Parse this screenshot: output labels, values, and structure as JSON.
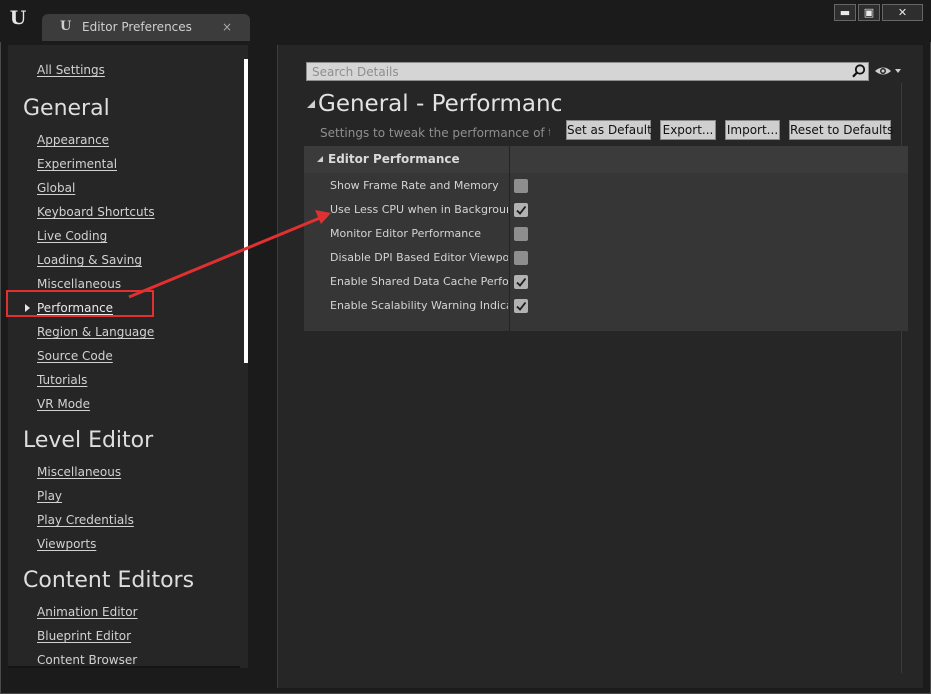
{
  "window": {
    "tab_title": "Editor Preferences",
    "tab_close": "×",
    "minimize": "▬",
    "maximize": "▣",
    "close": "✕"
  },
  "sidebar": {
    "all_settings": "All Settings",
    "sections": [
      {
        "header": "General",
        "items": [
          "Appearance",
          "Experimental",
          "Global",
          "Keyboard Shortcuts",
          "Live Coding",
          "Loading & Saving",
          "Miscellaneous",
          "Performance",
          "Region & Language",
          "Source Code",
          "Tutorials",
          "VR Mode"
        ]
      },
      {
        "header": "Level Editor",
        "items": [
          "Miscellaneous",
          "Play",
          "Play Credentials",
          "Viewports"
        ]
      },
      {
        "header": "Content Editors",
        "items": [
          "Animation Editor",
          "Blueprint Editor",
          "Content Browser"
        ]
      }
    ],
    "selected": "Performance"
  },
  "details": {
    "search_placeholder": "Search Details",
    "title": "General - Performance",
    "subtitle": "Settings to tweak the performance of the editor",
    "buttons": {
      "set_default": "Set as Default",
      "export": "Export...",
      "import": "Import...",
      "reset": "Reset to Defaults"
    },
    "category": {
      "title": "Editor Performance",
      "properties": [
        {
          "label": "Show Frame Rate and Memory",
          "checked": false
        },
        {
          "label": "Use Less CPU when in Background",
          "checked": true
        },
        {
          "label": "Monitor Editor Performance",
          "checked": false
        },
        {
          "label": "Disable DPI Based Editor Viewport Scaling",
          "checked": false
        },
        {
          "label": "Enable Shared Data Cache Performance Notifications",
          "checked": true
        },
        {
          "label": "Enable Scalability Warning Indicator",
          "checked": true
        }
      ]
    }
  },
  "colors": {
    "annotation": "#e03030",
    "background": "#1b1b1b",
    "panel": "#262626"
  }
}
